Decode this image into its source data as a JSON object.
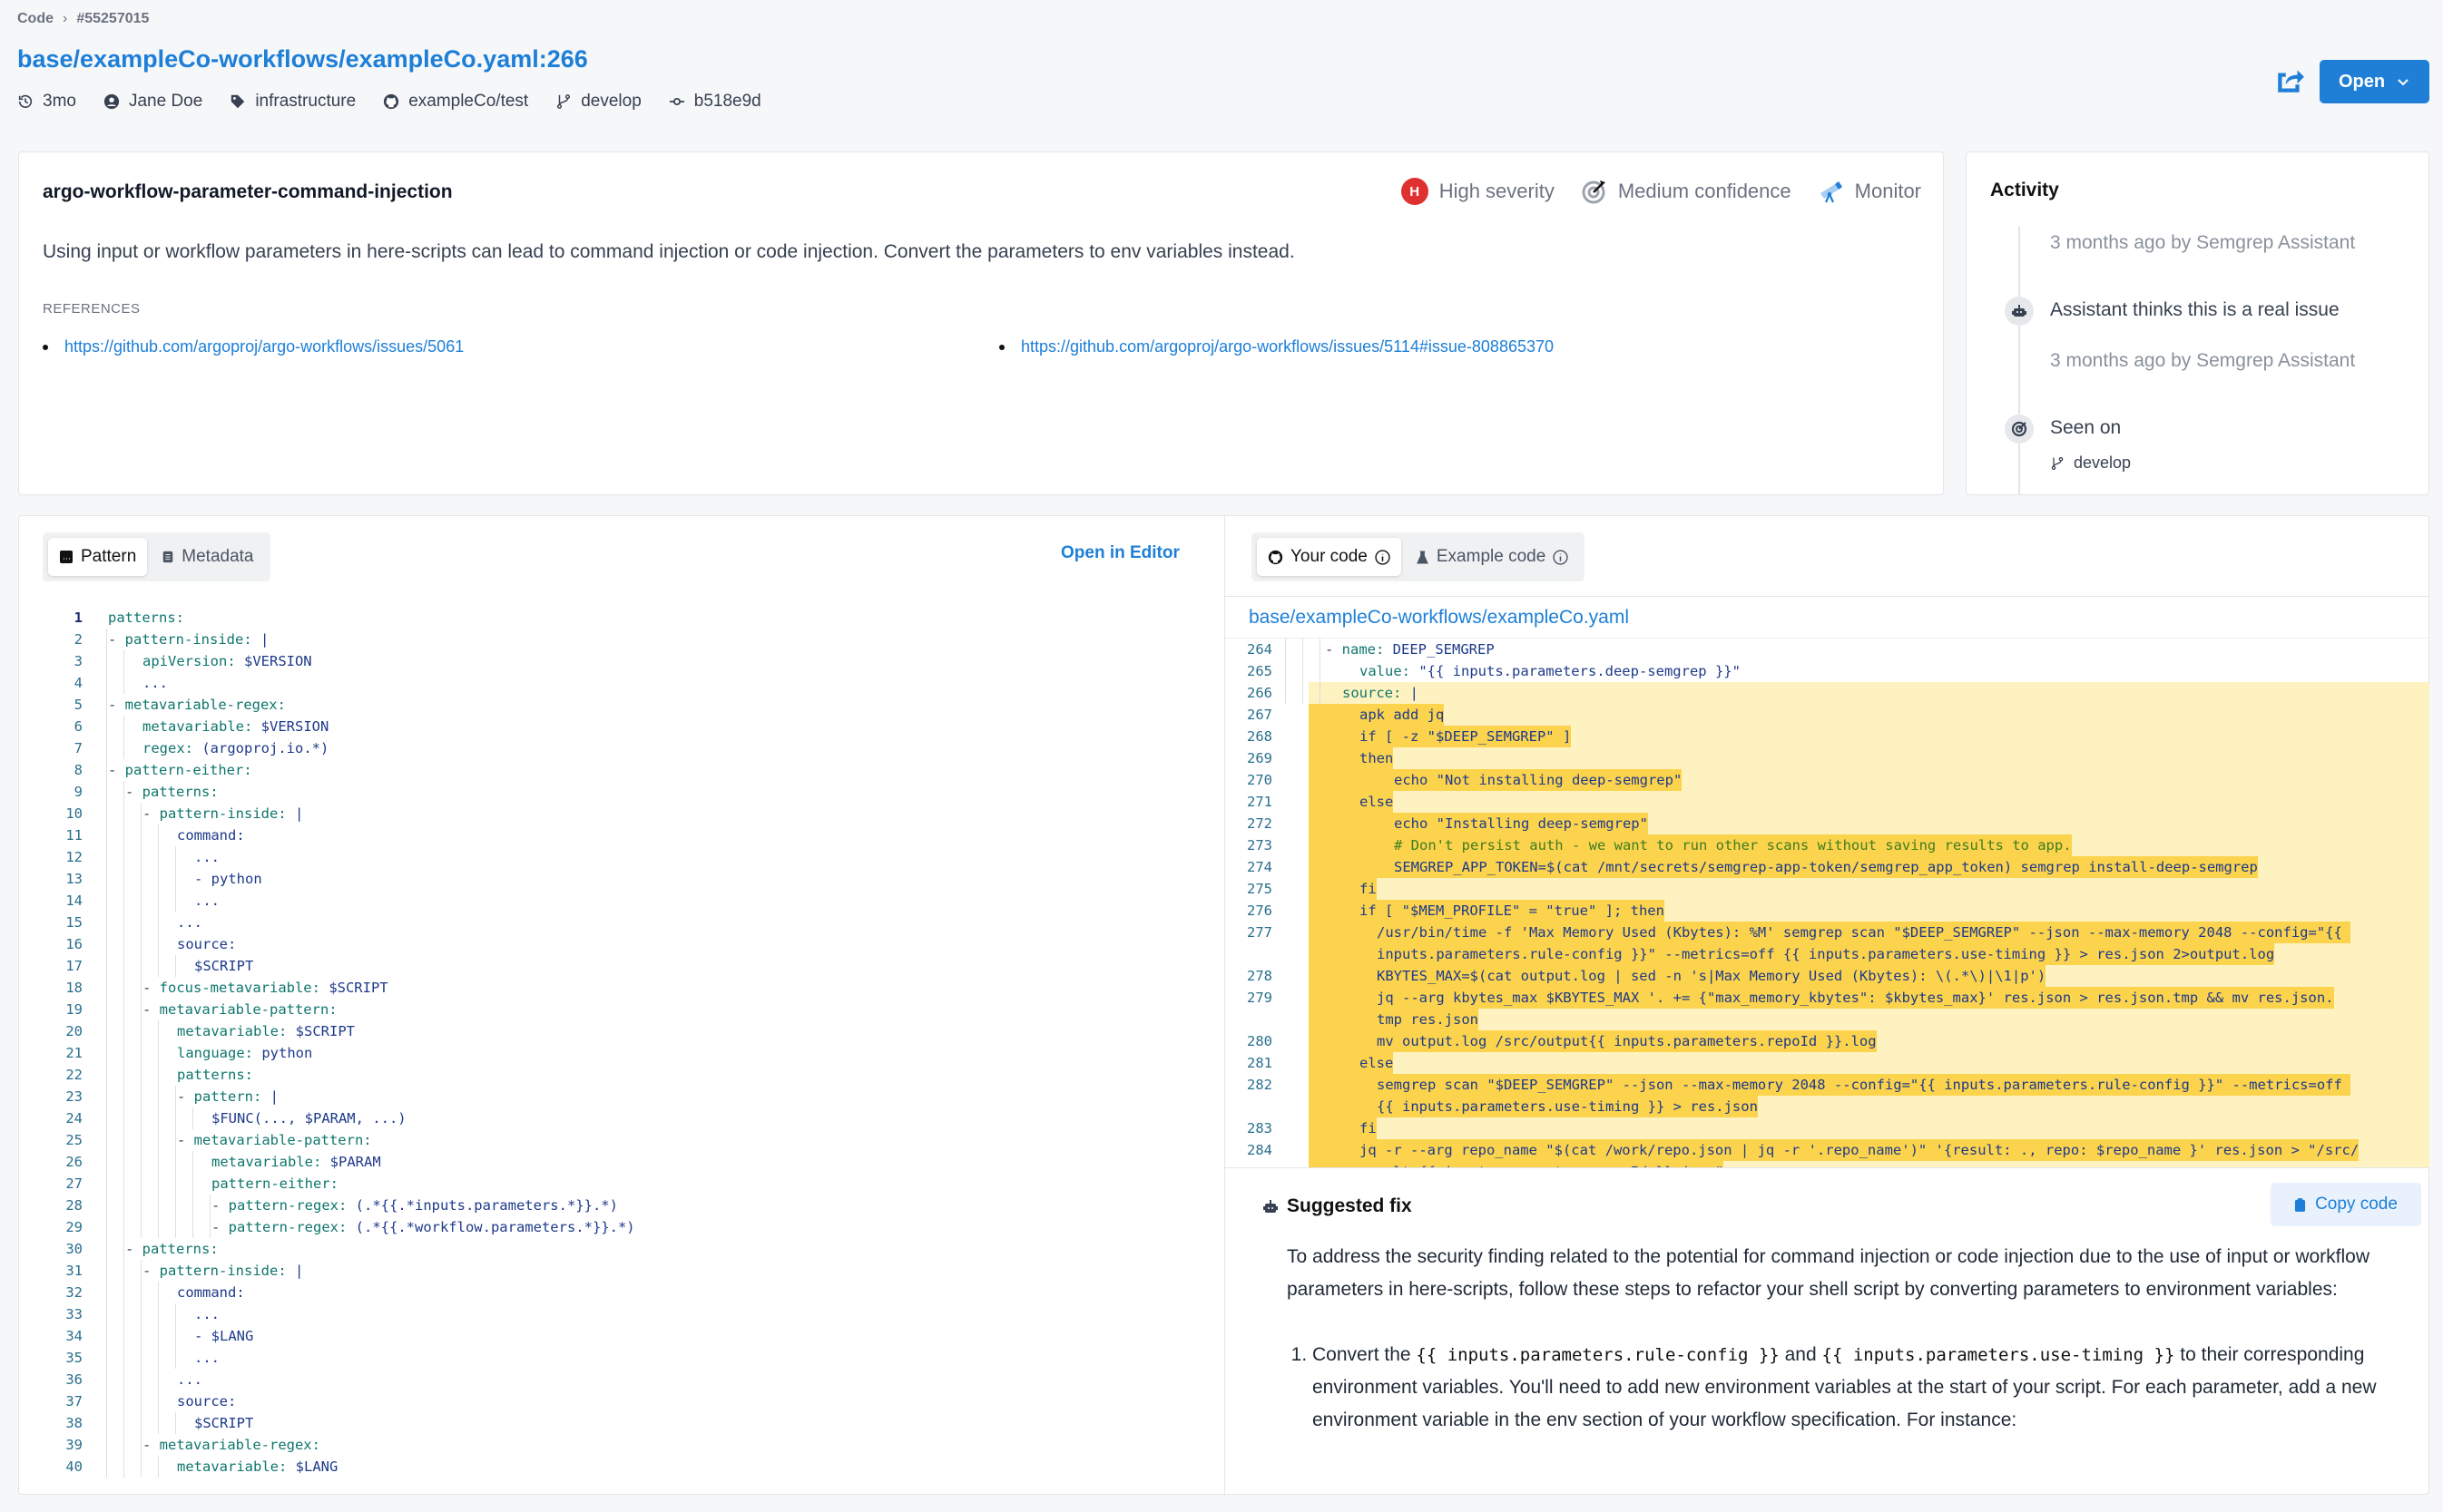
{
  "breadcrumb": {
    "root": "Code",
    "id": "#55257015"
  },
  "title": "base/exampleCo-workflows/exampleCo.yaml:266",
  "meta": {
    "age": "3mo",
    "author": "Jane Doe",
    "tag": "infrastructure",
    "repo": "exampleCo/test",
    "branch": "develop",
    "commit": "b518e9d"
  },
  "actions": {
    "open_label": "Open"
  },
  "finding": {
    "rule_name": "argo-workflow-parameter-command-injection",
    "severity_letter": "H",
    "severity": "High severity",
    "confidence": "Medium confidence",
    "mode": "Monitor",
    "description": "Using input or workflow parameters in here-scripts can lead to command injection or code injection. Convert the parameters to env variables instead.",
    "references_label": "REFERENCES",
    "references": [
      "https://github.com/argoproj/argo-workflows/issues/5061",
      "https://github.com/argoproj/argo-workflows/issues/5114#issue-808865370"
    ]
  },
  "activity": {
    "title": "Activity",
    "events": [
      {
        "text": "3 months ago by Semgrep Assistant"
      },
      {
        "text": "Assistant thinks this is a real issue"
      },
      {
        "text": "3 months ago by Semgrep Assistant"
      },
      {
        "text": "Seen on"
      }
    ],
    "branch": "develop"
  },
  "pattern_panel": {
    "tabs": [
      "Pattern",
      "Metadata"
    ],
    "open_in_editor": "Open in Editor",
    "lines": [
      {
        "n": "1",
        "i": 0,
        "k": "patterns:",
        "v": ""
      },
      {
        "n": "2",
        "i": 1,
        "d": "- ",
        "k": "pattern-inside:",
        "v": " |"
      },
      {
        "n": "3",
        "i": 2,
        "k": "apiVersion:",
        "v": " $VERSION"
      },
      {
        "n": "4",
        "i": 2,
        "k": "",
        "v": "..."
      },
      {
        "n": "5",
        "i": 1,
        "d": "- ",
        "k": "metavariable-regex:",
        "v": ""
      },
      {
        "n": "6",
        "i": 2,
        "k": "metavariable:",
        "v": " $VERSION"
      },
      {
        "n": "7",
        "i": 2,
        "k": "regex:",
        "v": " (argoproj.io.*)"
      },
      {
        "n": "8",
        "i": 1,
        "d": "- ",
        "k": "pattern-either:",
        "v": ""
      },
      {
        "n": "9",
        "i": 2,
        "d": "- ",
        "k": "patterns:",
        "v": ""
      },
      {
        "n": "10",
        "i": 3,
        "d": "- ",
        "k": "pattern-inside:",
        "v": " |"
      },
      {
        "n": "11",
        "i": 4,
        "k": "",
        "v": "command:"
      },
      {
        "n": "12",
        "i": 5,
        "k": "",
        "v": "..."
      },
      {
        "n": "13",
        "i": 5,
        "k": "",
        "v": "- python"
      },
      {
        "n": "14",
        "i": 5,
        "k": "",
        "v": "..."
      },
      {
        "n": "15",
        "i": 4,
        "k": "",
        "v": "..."
      },
      {
        "n": "16",
        "i": 4,
        "k": "",
        "v": "source:"
      },
      {
        "n": "17",
        "i": 5,
        "k": "",
        "v": "$SCRIPT"
      },
      {
        "n": "18",
        "i": 3,
        "d": "- ",
        "k": "focus-metavariable:",
        "v": " $SCRIPT"
      },
      {
        "n": "19",
        "i": 3,
        "d": "- ",
        "k": "metavariable-pattern:",
        "v": ""
      },
      {
        "n": "20",
        "i": 4,
        "k": "metavariable:",
        "v": " $SCRIPT"
      },
      {
        "n": "21",
        "i": 4,
        "k": "language:",
        "v": " python"
      },
      {
        "n": "22",
        "i": 4,
        "k": "patterns:",
        "v": ""
      },
      {
        "n": "23",
        "i": 5,
        "d": "- ",
        "k": "pattern:",
        "v": " |"
      },
      {
        "n": "24",
        "i": 6,
        "k": "",
        "v": "$FUNC(..., $PARAM, ...)"
      },
      {
        "n": "25",
        "i": 5,
        "d": "- ",
        "k": "metavariable-pattern:",
        "v": ""
      },
      {
        "n": "26",
        "i": 6,
        "k": "metavariable:",
        "v": " $PARAM"
      },
      {
        "n": "27",
        "i": 6,
        "k": "pattern-either:",
        "v": ""
      },
      {
        "n": "28",
        "i": 7,
        "d": "- ",
        "k": "pattern-regex:",
        "v": " (.*{{.*inputs.parameters.*}}.*)"
      },
      {
        "n": "29",
        "i": 7,
        "d": "- ",
        "k": "pattern-regex:",
        "v": " (.*{{.*workflow.parameters.*}}.*)"
      },
      {
        "n": "30",
        "i": 2,
        "d": "- ",
        "k": "patterns:",
        "v": ""
      },
      {
        "n": "31",
        "i": 3,
        "d": "- ",
        "k": "pattern-inside:",
        "v": " |"
      },
      {
        "n": "32",
        "i": 4,
        "k": "",
        "v": "command:"
      },
      {
        "n": "33",
        "i": 5,
        "k": "",
        "v": "..."
      },
      {
        "n": "34",
        "i": 5,
        "k": "",
        "v": "- $LANG"
      },
      {
        "n": "35",
        "i": 5,
        "k": "",
        "v": "..."
      },
      {
        "n": "36",
        "i": 4,
        "k": "",
        "v": "..."
      },
      {
        "n": "37",
        "i": 4,
        "k": "",
        "v": "source:"
      },
      {
        "n": "38",
        "i": 5,
        "k": "",
        "v": "$SCRIPT"
      },
      {
        "n": "39",
        "i": 3,
        "d": "- ",
        "k": "metavariable-regex:",
        "v": ""
      },
      {
        "n": "40",
        "i": 4,
        "k": "metavariable:",
        "v": " $LANG"
      }
    ]
  },
  "code_panel": {
    "tabs": [
      "Your code",
      "Example code"
    ],
    "file_path": "base/exampleCo-workflows/exampleCo.yaml",
    "lines": [
      {
        "n": "264",
        "i": 3,
        "t": "- name: DEEP_SEMGREP",
        "hl": false,
        "kv": [
          "- ",
          "name:",
          " DEEP_SEMGREP"
        ]
      },
      {
        "n": "265",
        "i": 4,
        "t": "value: \"{{ inputs.parameters.deep-semgrep }}\"",
        "hl": false,
        "kv": [
          "",
          "value:",
          " \"{{ inputs.parameters.deep-semgrep }}\""
        ]
      },
      {
        "n": "266",
        "i": 3,
        "t": "source: |",
        "hl": "light",
        "kv": [
          "",
          "source:",
          " |"
        ]
      },
      {
        "n": "267",
        "i": 4,
        "t": "apk add jq",
        "hl": true
      },
      {
        "n": "268",
        "i": 4,
        "t": "if [ -z \"$DEEP_SEMGREP\" ]",
        "hl": true
      },
      {
        "n": "269",
        "i": 4,
        "t": "then",
        "hl": true
      },
      {
        "n": "270",
        "i": 6,
        "t": "echo \"Not installing deep-semgrep\"",
        "hl": true
      },
      {
        "n": "271",
        "i": 4,
        "t": "else",
        "hl": true
      },
      {
        "n": "272",
        "i": 6,
        "t": "echo \"Installing deep-semgrep\"",
        "hl": true
      },
      {
        "n": "273",
        "i": 6,
        "t": "# Don't persist auth - we want to run other scans without saving results to app.",
        "hl": true,
        "comment": true
      },
      {
        "n": "274",
        "i": 6,
        "t": "SEMGREP_APP_TOKEN=$(cat /mnt/secrets/semgrep-app-token/semgrep_app_token) semgrep install-deep-semgrep",
        "hl": true
      },
      {
        "n": "275",
        "i": 4,
        "t": "fi",
        "hl": true
      },
      {
        "n": "276",
        "i": 4,
        "t": "if [ \"$MEM_PROFILE\" = \"true\" ]; then",
        "hl": true
      },
      {
        "n": "277",
        "i": 5,
        "t": "/usr/bin/time -f 'Max Memory Used (Kbytes): %M' semgrep scan \"$DEEP_SEMGREP\" --json --max-memory 2048 --config=\"{{ ",
        "hl": true
      },
      {
        "n": "",
        "i": 5,
        "t": "inputs.parameters.rule-config }}\" --metrics=off {{ inputs.parameters.use-timing }} > res.json 2>output.log",
        "hl": true
      },
      {
        "n": "278",
        "i": 5,
        "t": "KBYTES_MAX=$(cat output.log | sed -n 's|Max Memory Used (Kbytes): \\(.*\\)|\\1|p')",
        "hl": true
      },
      {
        "n": "279",
        "i": 5,
        "t": "jq --arg kbytes_max $KBYTES_MAX '. += {\"max_memory_kbytes\": $kbytes_max}' res.json > res.json.tmp && mv res.json.",
        "hl": true
      },
      {
        "n": "",
        "i": 5,
        "t": "tmp res.json",
        "hl": true
      },
      {
        "n": "280",
        "i": 5,
        "t": "mv output.log /src/output{{ inputs.parameters.repoId }}.log",
        "hl": true
      },
      {
        "n": "281",
        "i": 4,
        "t": "else",
        "hl": true
      },
      {
        "n": "282",
        "i": 5,
        "t": "semgrep scan \"$DEEP_SEMGREP\" --json --max-memory 2048 --config=\"{{ inputs.parameters.rule-config }}\" --metrics=off ",
        "hl": true
      },
      {
        "n": "",
        "i": 5,
        "t": "{{ inputs.parameters.use-timing }} > res.json",
        "hl": true
      },
      {
        "n": "283",
        "i": 4,
        "t": "fi",
        "hl": true
      },
      {
        "n": "284",
        "i": 4,
        "t": "jq -r --arg repo_name \"$(cat /work/repo.json | jq -r '.repo_name')\" '{result: ., repo: $repo_name }' res.json > \"/src/",
        "hl": true
      },
      {
        "n": "",
        "i": 4,
        "t": "results{{ inputs.parameters.repoId }}.json\"",
        "hl": true
      }
    ]
  },
  "suggested_fix": {
    "title": "Suggested fix",
    "copy_label": "Copy code",
    "intro": "To address the security finding related to the potential for command injection or code injection due to the use of input or workflow parameters in here-scripts, follow these steps to refactor your shell script by converting parameters to environment variables:",
    "step1_prefix": "Convert the ",
    "step1_code1": "{{ inputs.parameters.rule-config }}",
    "step1_mid": " and ",
    "step1_code2": "{{ inputs.parameters.use-timing }}",
    "step1_suffix": " to their corresponding environment variables. You'll need to add new environment variables at the start of your script. For each parameter, add a new environment variable in the env section of your workflow specification. For instance:"
  }
}
